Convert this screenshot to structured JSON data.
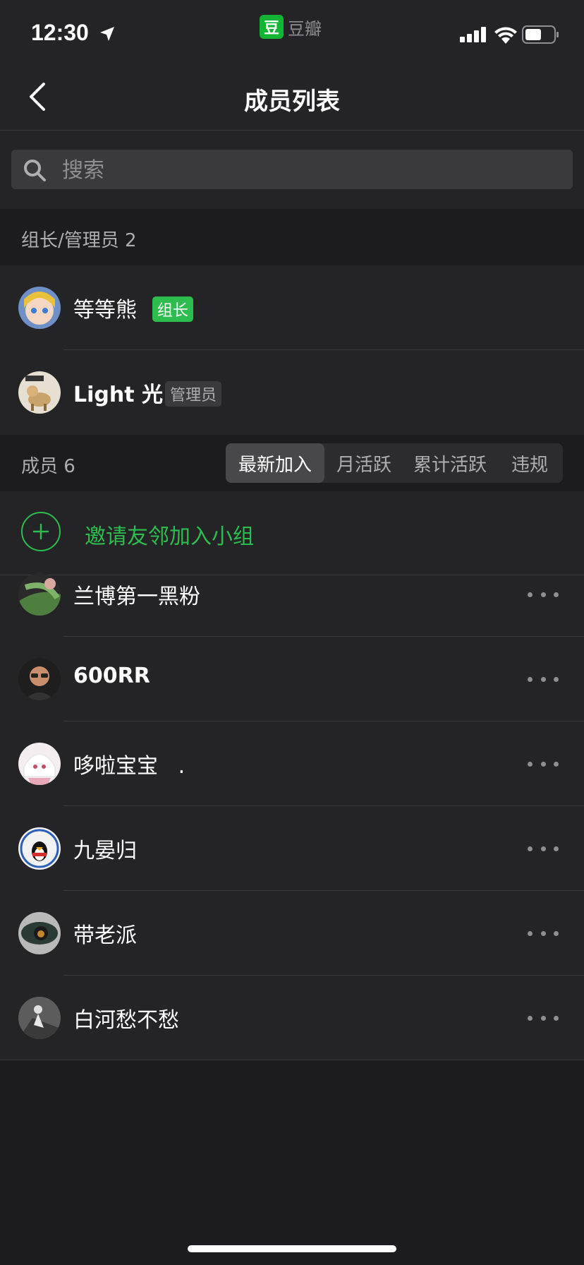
{
  "status_bar": {
    "time": "12:30",
    "app_name": "豆瓣",
    "app_logo_char": "豆",
    "accent": "#11b533"
  },
  "nav": {
    "title": "成员列表"
  },
  "search": {
    "placeholder": "搜索"
  },
  "admins_section": {
    "label": "组长/管理员 2",
    "members": [
      {
        "name": "等等熊",
        "badge": "组长"
      },
      {
        "name": "Light 光",
        "badge": "管理员"
      }
    ]
  },
  "members_section": {
    "label": "成员 6",
    "tabs": [
      {
        "label": "最新加入",
        "active": true
      },
      {
        "label": "月活跃",
        "active": false
      },
      {
        "label": "累计活跃",
        "active": false
      },
      {
        "label": "违规",
        "active": false
      }
    ],
    "invite_label": "邀请友邻加入小组",
    "members": [
      {
        "name": "兰博第一黑粉"
      },
      {
        "name": "600RR"
      },
      {
        "name": "哆啦宝宝   ."
      },
      {
        "name": "九晏归"
      },
      {
        "name": "带老派"
      },
      {
        "name": "白河愁不愁"
      }
    ]
  },
  "colors": {
    "background": "#1c1c1e",
    "surface": "#242426",
    "green": "#2dbd4e"
  }
}
